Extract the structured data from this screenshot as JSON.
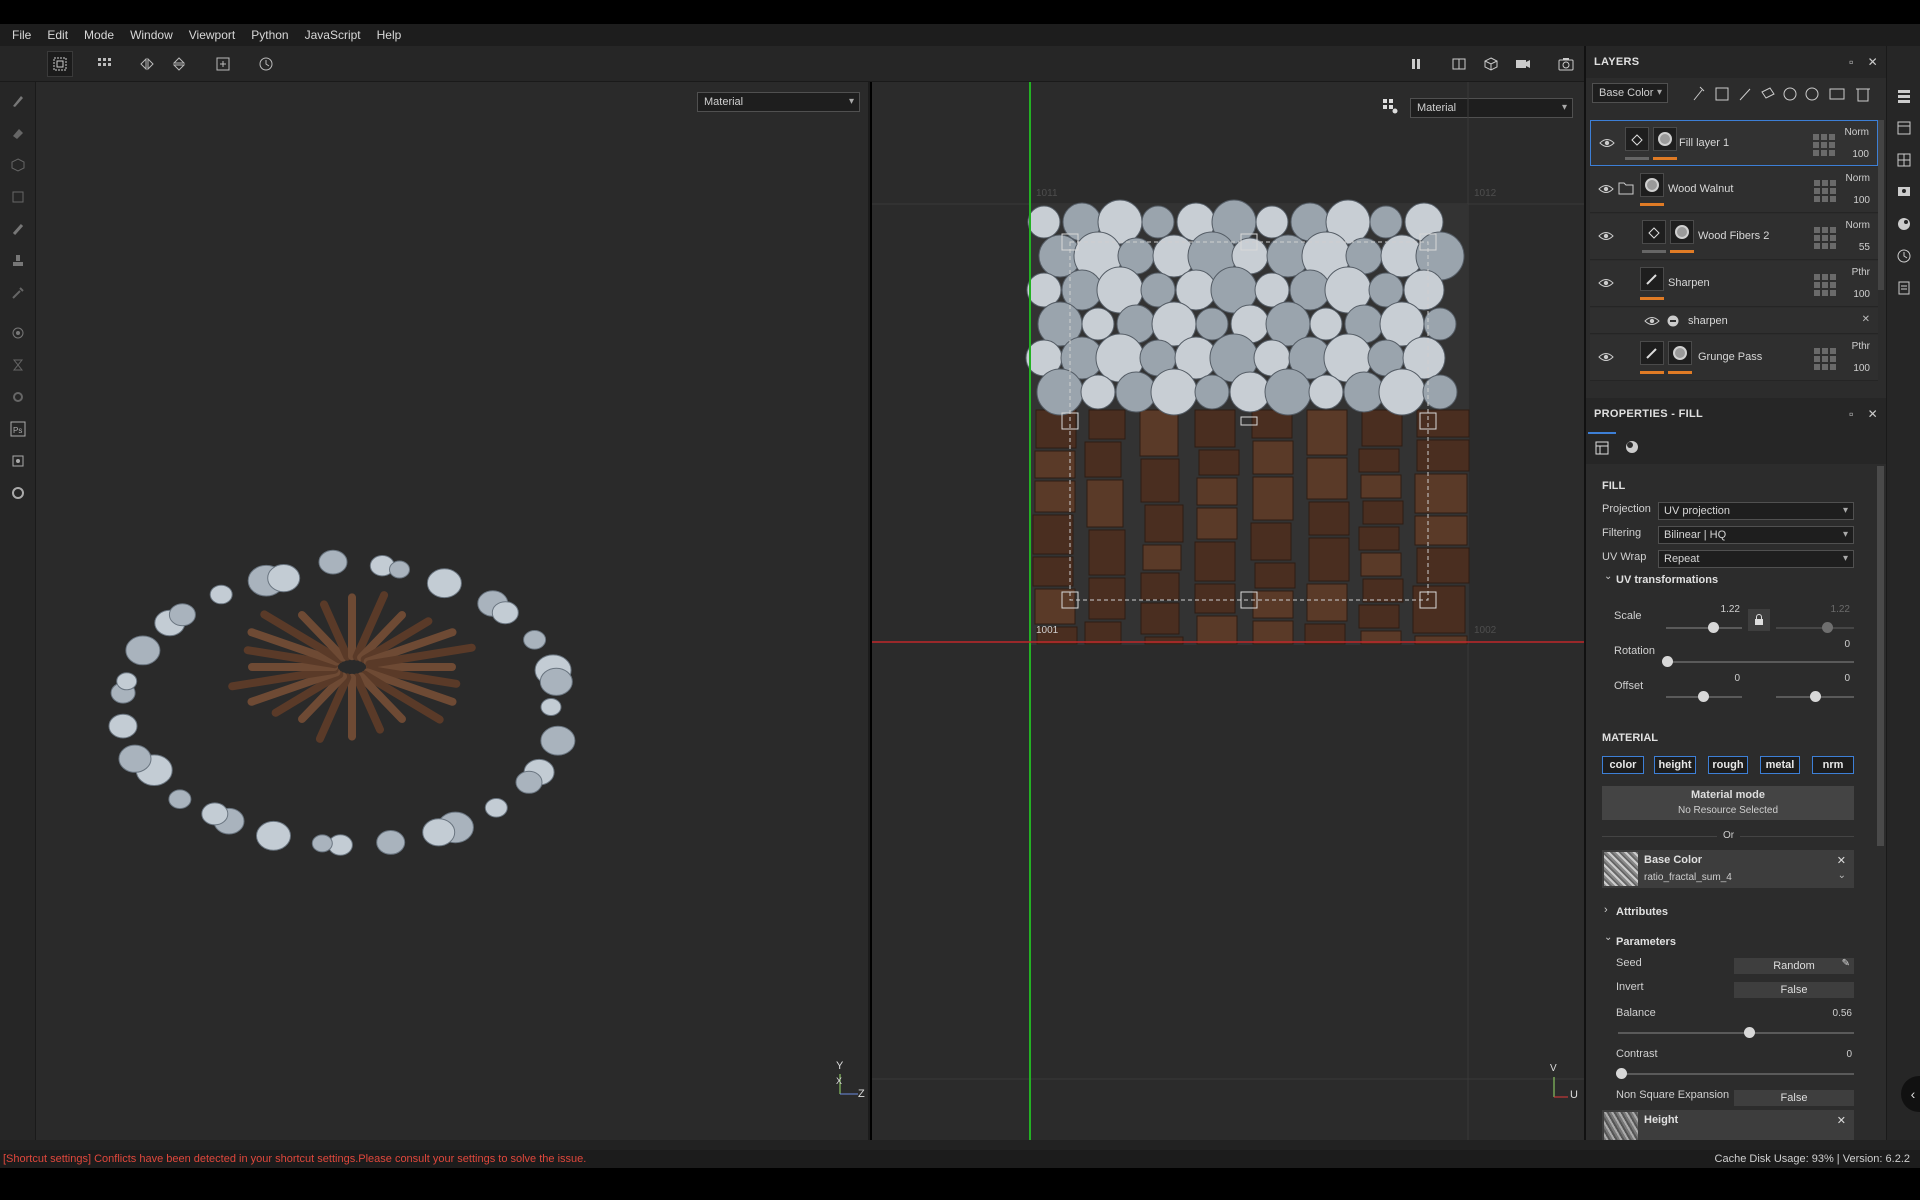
{
  "menu": [
    "File",
    "Edit",
    "Mode",
    "Window",
    "Viewport",
    "Python",
    "JavaScript",
    "Help"
  ],
  "viewport3d": {
    "mode_select": "Material",
    "axis_y": "Y",
    "axis_x": "X",
    "axis_z": "Z"
  },
  "viewport2d": {
    "mode_select": "Material",
    "udim_top_left": "1011",
    "udim_top_right": "1012",
    "udim_bottom_left": "1001",
    "udim_bottom_right": "1002",
    "axis_v": "V",
    "axis_u": "U"
  },
  "layers": {
    "title": "LAYERS",
    "channel_select": "Base Color",
    "rows": [
      {
        "name": "Fill layer 1",
        "blend": "Norm",
        "opacity": "100"
      },
      {
        "name": "Wood Walnut",
        "blend": "Norm",
        "opacity": "100"
      },
      {
        "name": "Wood Fibers 2",
        "blend": "Norm",
        "opacity": "55"
      },
      {
        "name": "Sharpen",
        "blend": "Pthr",
        "opacity": "100"
      },
      {
        "name": "sharpen"
      },
      {
        "name": "Grunge Pass",
        "blend": "Pthr",
        "opacity": "100"
      }
    ]
  },
  "properties": {
    "title": "PROPERTIES - FILL",
    "fill_title": "FILL",
    "projection_label": "Projection",
    "projection_value": "UV projection",
    "filtering_label": "Filtering",
    "filtering_value": "Bilinear | HQ",
    "uvwrap_label": "UV Wrap",
    "uvwrap_value": "Repeat",
    "uv_transform_title": "UV transformations",
    "scale_label": "Scale",
    "scale_value": "1.22",
    "scale_value2": "1.22",
    "rotation_label": "Rotation",
    "rotation_value": "0",
    "offset_label": "Offset",
    "offset_u": "0",
    "offset_v": "0",
    "material_title": "MATERIAL",
    "channels": [
      "color",
      "height",
      "rough",
      "metal",
      "nrm"
    ],
    "material_mode": "Material mode",
    "no_resource": "No Resource Selected",
    "or_label": "Or",
    "base_color_title": "Base Color",
    "base_color_resource": "ratio_fractal_sum_4",
    "attributes_title": "Attributes",
    "parameters_title": "Parameters",
    "seed_label": "Seed",
    "seed_value": "Random",
    "invert_label": "Invert",
    "invert_value": "False",
    "balance_label": "Balance",
    "balance_value": "0.56",
    "contrast_label": "Contrast",
    "contrast_value": "0",
    "nse_label": "Non Square Expansion",
    "nse_value": "False",
    "height_title": "Height"
  },
  "status": {
    "warning": "[Shortcut settings] Conflicts have been detected in your shortcut settings.Please consult your settings to solve the issue.",
    "cache": "Cache Disk Usage:    93% | Version: 6.2.2"
  },
  "colors": {
    "accent_blue": "#3d7fd6",
    "orange": "#e07b25",
    "warning_red": "#e0473c"
  }
}
